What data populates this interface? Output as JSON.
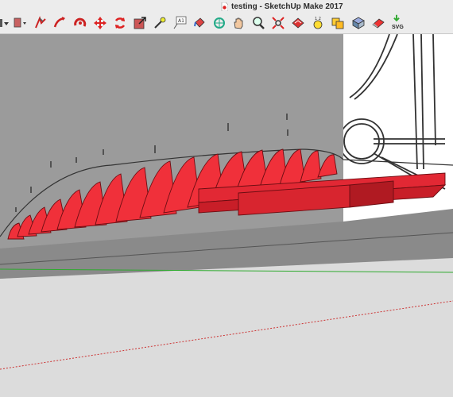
{
  "window": {
    "title": "testing - SketchUp Make 2017"
  },
  "toolbar": {
    "tools": [
      {
        "name": "menu-dropdown",
        "icon": "chevron-down-icon"
      },
      {
        "name": "layer-dropdown",
        "icon": "layer-dropdown-icon"
      },
      {
        "name": "follow-me",
        "icon": "follow-me-icon"
      },
      {
        "name": "orbit",
        "icon": "orbit-icon"
      },
      {
        "name": "move",
        "icon": "move-icon"
      },
      {
        "name": "rotate",
        "icon": "rotate-icon"
      },
      {
        "name": "scale",
        "icon": "scale-icon"
      },
      {
        "name": "dimension",
        "icon": "dimension-icon"
      },
      {
        "name": "text",
        "icon": "text-icon"
      },
      {
        "name": "paint-bucket",
        "icon": "paint-bucket-icon"
      },
      {
        "name": "pan",
        "icon": "pan-icon"
      },
      {
        "name": "zoom",
        "icon": "zoom-icon"
      },
      {
        "name": "zoom-extents",
        "icon": "zoom-extents-icon"
      },
      {
        "name": "section-plane",
        "icon": "section-plane-icon"
      },
      {
        "name": "tape-measure",
        "icon": "tape-measure-icon"
      },
      {
        "name": "warehouse",
        "icon": "warehouse-icon"
      },
      {
        "name": "components",
        "icon": "components-icon"
      },
      {
        "name": "eraser",
        "icon": "eraser-icon"
      },
      {
        "name": "export-svg",
        "icon": "download-arrow-icon",
        "label": "SVG"
      }
    ]
  },
  "colors": {
    "toolbar_bg": "#ececec",
    "backdrop_gray": "#9b9b9b",
    "ground": "#dcdcdc",
    "rib_red": "#f0303a",
    "rib_dark": "#b01a22",
    "axis_green": "#2eaa2e",
    "axis_red": "#cc3333"
  }
}
